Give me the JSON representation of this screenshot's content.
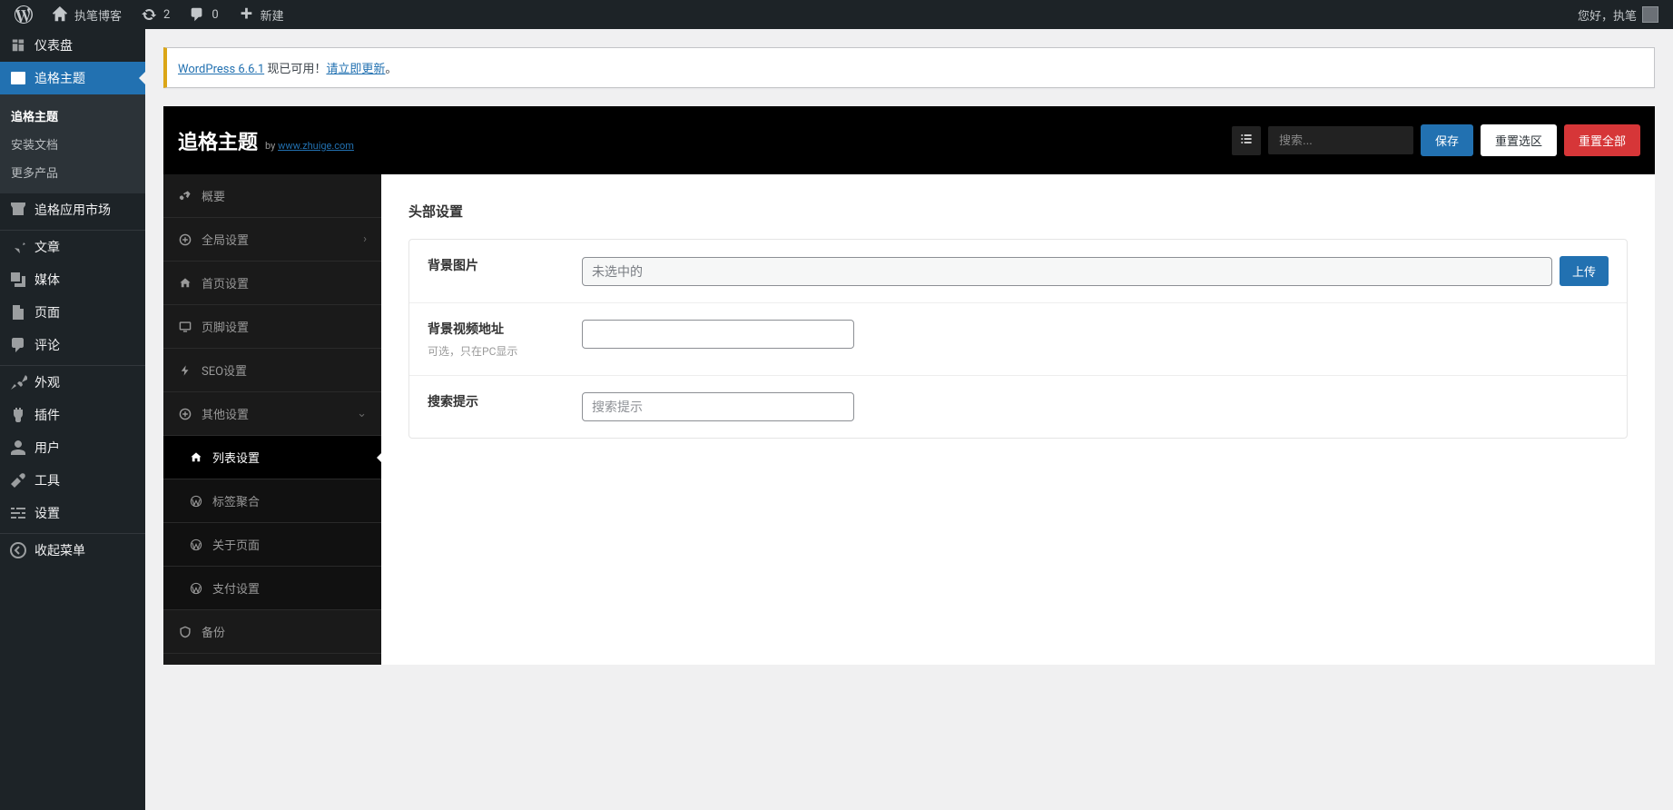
{
  "adminbar": {
    "site_name": "执笔博客",
    "updates_count": "2",
    "comments_count": "0",
    "new_label": "新建",
    "greeting": "您好，执笔"
  },
  "wp_menu": {
    "dashboard": "仪表盘",
    "zhuige_theme": "追格主题",
    "market": "追格应用市场",
    "posts": "文章",
    "media": "媒体",
    "pages": "页面",
    "comments": "评论",
    "appearance": "外观",
    "plugins": "插件",
    "users": "用户",
    "tools": "工具",
    "settings": "设置",
    "collapse": "收起菜单",
    "submenu": {
      "theme": "追格主题",
      "install_doc": "安装文档",
      "more_products": "更多产品"
    }
  },
  "notice": {
    "link1": "WordPress 6.6.1",
    "text1": " 现已可用！",
    "link2": "请立即更新",
    "punct": "。"
  },
  "panel": {
    "title": "追格主题",
    "by": "by",
    "by_url_text": "www.zhuige.com",
    "search_placeholder": "搜索...",
    "save": "保存",
    "reset_section": "重置选区",
    "reset_all": "重置全部",
    "nav": {
      "overview": "概要",
      "global": "全局设置",
      "home": "首页设置",
      "footer": "页脚设置",
      "seo": "SEO设置",
      "other": "其他设置",
      "list": "列表设置",
      "tags": "标签聚合",
      "about": "关于页面",
      "payment": "支付设置",
      "backup": "备份"
    }
  },
  "form": {
    "section_title": "头部设置",
    "bg_image": {
      "label": "背景图片",
      "value": "未选中的",
      "upload": "上传"
    },
    "bg_video": {
      "label": "背景视频地址",
      "hint": "可选，只在PC显示"
    },
    "search_hint": {
      "label": "搜索提示",
      "placeholder": "搜索提示"
    }
  }
}
